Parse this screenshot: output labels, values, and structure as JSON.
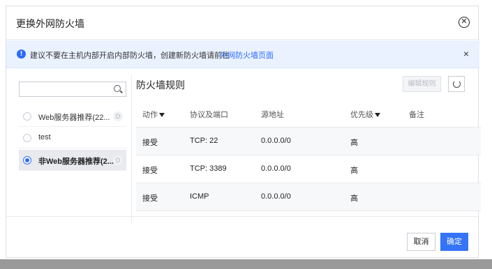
{
  "dialog": {
    "title": "更换外网防火墙",
    "close_icon": "circle-x-icon"
  },
  "alert": {
    "text": "建议不要在主机内部开启内部防火墙，创建新防火墙请前往",
    "link": "外网防火墙页面",
    "close": "×"
  },
  "search": {
    "placeholder": "",
    "value": ""
  },
  "firewall_list": [
    {
      "name": "Web服务器推荐(22...",
      "badge": "D",
      "selected": false
    },
    {
      "name": "test",
      "badge": "",
      "selected": false
    },
    {
      "name": "非Web服务器推荐(2...",
      "badge": "D",
      "selected": true
    }
  ],
  "panel": {
    "title": "防火墙规则",
    "edit_button": "编辑规则"
  },
  "table": {
    "headers": [
      "动作",
      "协议及端口",
      "源地址",
      "优先级",
      "备注"
    ],
    "rows": [
      {
        "action": "接受",
        "protocol": "TCP: 22",
        "source": "0.0.0.0/0",
        "priority": "高",
        "note": ""
      },
      {
        "action": "接受",
        "protocol": "TCP: 3389",
        "source": "0.0.0.0/0",
        "priority": "高",
        "note": ""
      },
      {
        "action": "接受",
        "protocol": "ICMP",
        "source": "0.0.0.0/0",
        "priority": "高",
        "note": ""
      }
    ]
  },
  "footer": {
    "cancel": "取消",
    "confirm": "确定"
  },
  "colors": {
    "accent": "#3574f6",
    "alert_bg": "#eaf2ff"
  }
}
